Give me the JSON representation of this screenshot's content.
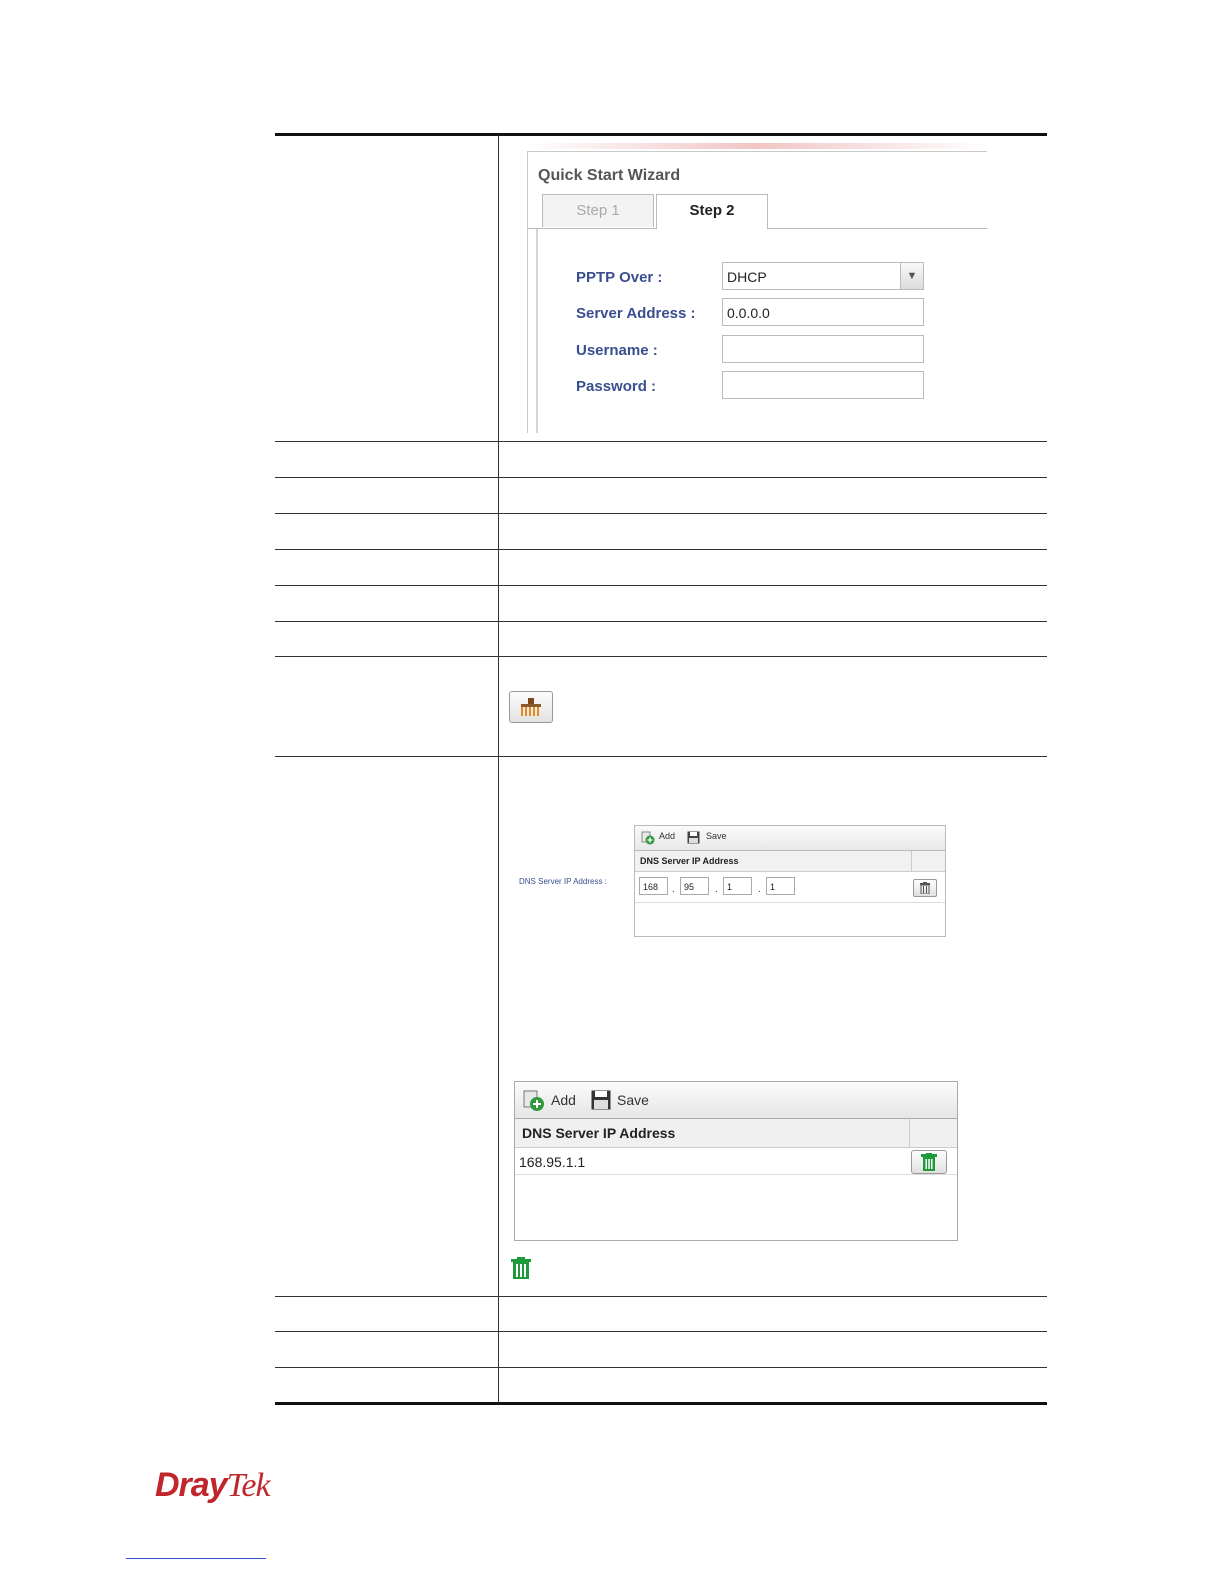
{
  "wizard": {
    "title": "Quick Start Wizard",
    "tabs": [
      "Step 1",
      "Step 2"
    ],
    "fields": {
      "pptp_over": {
        "label": "PPTP Over :",
        "value": "DHCP"
      },
      "server_address": {
        "label": "Server Address :",
        "value": "0.0.0.0"
      },
      "username": {
        "label": "Username :",
        "value": ""
      },
      "password": {
        "label": "Password :",
        "value": ""
      }
    }
  },
  "dns_small": {
    "field_label": "DNS Server IP Address :",
    "toolbar": {
      "add": "Add",
      "save": "Save"
    },
    "column": "DNS Server IP Address",
    "octets": [
      "168",
      "95",
      "1",
      "1"
    ]
  },
  "dns_large": {
    "toolbar": {
      "add": "Add",
      "save": "Save"
    },
    "column": "DNS Server IP Address",
    "entries": [
      "168.95.1.1"
    ]
  },
  "icons": {
    "clear": "broom-icon",
    "delete_grey": "trash-icon",
    "delete_green": "trash-green-icon",
    "add": "add-icon",
    "save": "save-icon"
  },
  "footer": {
    "logo_dray": "Dray",
    "logo_tek": "Tek"
  },
  "colors": {
    "label_blue": "#3a4f8f",
    "logo_red": "#c0272d",
    "trash_green": "#1e9a3c"
  }
}
